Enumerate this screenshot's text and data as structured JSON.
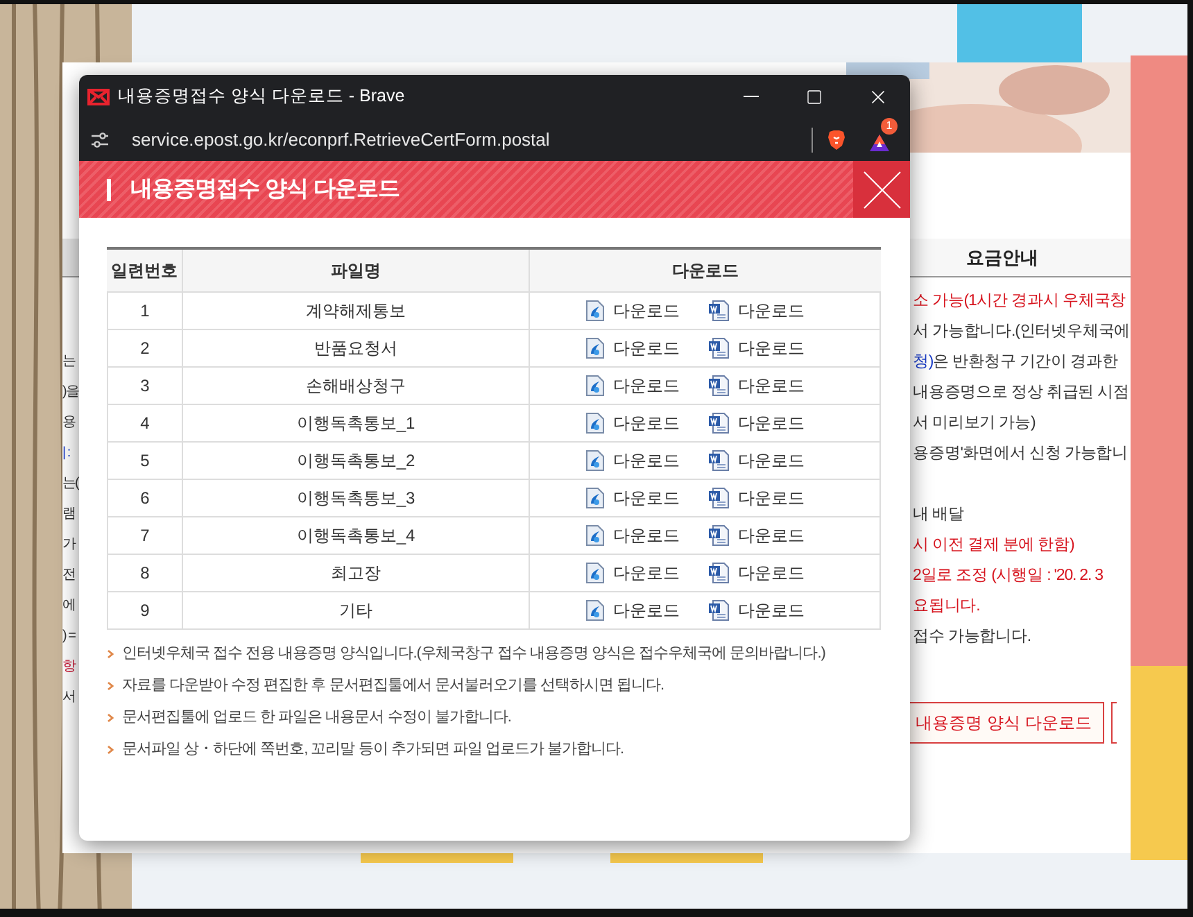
{
  "background_page": {
    "tab": "요금안내",
    "left_lines": [
      {
        "text": "는",
        "color": "#333333"
      },
      {
        "text": ")을",
        "color": "#333333"
      },
      {
        "text": "용",
        "color": "#333333"
      },
      {
        "text": "| :",
        "color": "#1a3cc8"
      },
      {
        "text": "는(",
        "color": "#333333"
      },
      {
        "text": "램",
        "color": "#333333"
      },
      {
        "text": "가",
        "color": "#333333"
      },
      {
        "text": "전",
        "color": "#333333"
      },
      {
        "text": "에",
        "color": "#333333"
      },
      {
        "text": ") =",
        "color": "#333333"
      },
      {
        "text": "항",
        "color": "#c8102e"
      },
      {
        "text": "서",
        "color": "#333333"
      }
    ],
    "right_lines": [
      {
        "segments": [
          {
            "text": "소 가능(1시간 경과시 우체국창",
            "color": "#d7141e"
          }
        ]
      },
      {
        "segments": [
          {
            "text": "서 가능합니다.(인터넷우체국에",
            "color": "#333333"
          }
        ]
      },
      {
        "segments": [
          {
            "text": "청)",
            "color": "#1a3cc8"
          },
          {
            "text": "은 반환청구 기간이 경과한",
            "color": "#333333"
          }
        ]
      },
      {
        "segments": [
          {
            "text": "내용증명으로 정상 취급된 시점",
            "color": "#333333"
          }
        ]
      },
      {
        "segments": [
          {
            "text": "서 미리보기 가능)",
            "color": "#333333"
          }
        ]
      },
      {
        "segments": [
          {
            "text": "용증명'화면에서 신청 가능합니",
            "color": "#333333"
          }
        ]
      },
      {
        "segments": [
          {
            "text": "내 배달",
            "color": "#333333"
          }
        ],
        "spaced": true
      },
      {
        "segments": [
          {
            "text": "시 이전 결제 분에 한함)",
            "color": "#d7141e"
          }
        ]
      },
      {
        "segments": [
          {
            "text": "2일로 조정 (시행일 : '20. 2. 3",
            "color": "#d7141e"
          }
        ]
      },
      {
        "segments": [
          {
            "text": "요됩니다.",
            "color": "#d7141e"
          }
        ]
      },
      {
        "segments": [
          {
            "text": "접수 가능합니다.",
            "color": "#333333"
          }
        ]
      }
    ],
    "button": "내용증명 양식 다운로드"
  },
  "popup": {
    "window_title": "내용증명접수 양식 다운로드 - Brave",
    "url": "service.epost.go.kr/econprf.RetrieveCertForm.postal",
    "extension_badge": "1",
    "header": "내용증명접수 양식 다운로드",
    "table": {
      "columns": [
        "일련번호",
        "파일명",
        "다운로드"
      ],
      "rows": [
        {
          "no": "1",
          "name": "계약해제통보",
          "downloads": [
            {
              "kind": "e",
              "label": "다운로드"
            },
            {
              "kind": "word",
              "label": "다운로드"
            }
          ]
        },
        {
          "no": "2",
          "name": "반품요청서",
          "downloads": [
            {
              "kind": "e",
              "label": "다운로드"
            },
            {
              "kind": "word",
              "label": "다운로드"
            }
          ]
        },
        {
          "no": "3",
          "name": "손해배상청구",
          "downloads": [
            {
              "kind": "e",
              "label": "다운로드"
            },
            {
              "kind": "word",
              "label": "다운로드"
            }
          ]
        },
        {
          "no": "4",
          "name": "이행독촉통보_1",
          "downloads": [
            {
              "kind": "e",
              "label": "다운로드"
            },
            {
              "kind": "word",
              "label": "다운로드"
            }
          ]
        },
        {
          "no": "5",
          "name": "이행독촉통보_2",
          "downloads": [
            {
              "kind": "e",
              "label": "다운로드"
            },
            {
              "kind": "word",
              "label": "다운로드"
            }
          ]
        },
        {
          "no": "6",
          "name": "이행독촉통보_3",
          "downloads": [
            {
              "kind": "e",
              "label": "다운로드"
            },
            {
              "kind": "word",
              "label": "다운로드"
            }
          ]
        },
        {
          "no": "7",
          "name": "이행독촉통보_4",
          "downloads": [
            {
              "kind": "e",
              "label": "다운로드"
            },
            {
              "kind": "word",
              "label": "다운로드"
            }
          ]
        },
        {
          "no": "8",
          "name": "최고장",
          "downloads": [
            {
              "kind": "e",
              "label": "다운로드"
            },
            {
              "kind": "word",
              "label": "다운로드"
            }
          ]
        },
        {
          "no": "9",
          "name": "기타",
          "downloads": [
            {
              "kind": "e",
              "label": "다운로드"
            },
            {
              "kind": "word",
              "label": "다운로드"
            }
          ]
        }
      ]
    },
    "notes": [
      "인터넷우체국 접수 전용 내용증명 양식입니다.(우체국창구 접수 내용증명 양식은 접수우체국에 문의바랍니다.)",
      "자료를 다운받아 수정 편집한 후 문서편집툴에서 문서불러오기를 선택하시면 됩니다.",
      "문서편집툴에 업로드 한 파일은 내용문서 수정이 불가합니다.",
      "문서파일 상・하단에 쪽번호, 꼬리말 등이 추가되면 파일 업로드가 불가합니다."
    ]
  }
}
